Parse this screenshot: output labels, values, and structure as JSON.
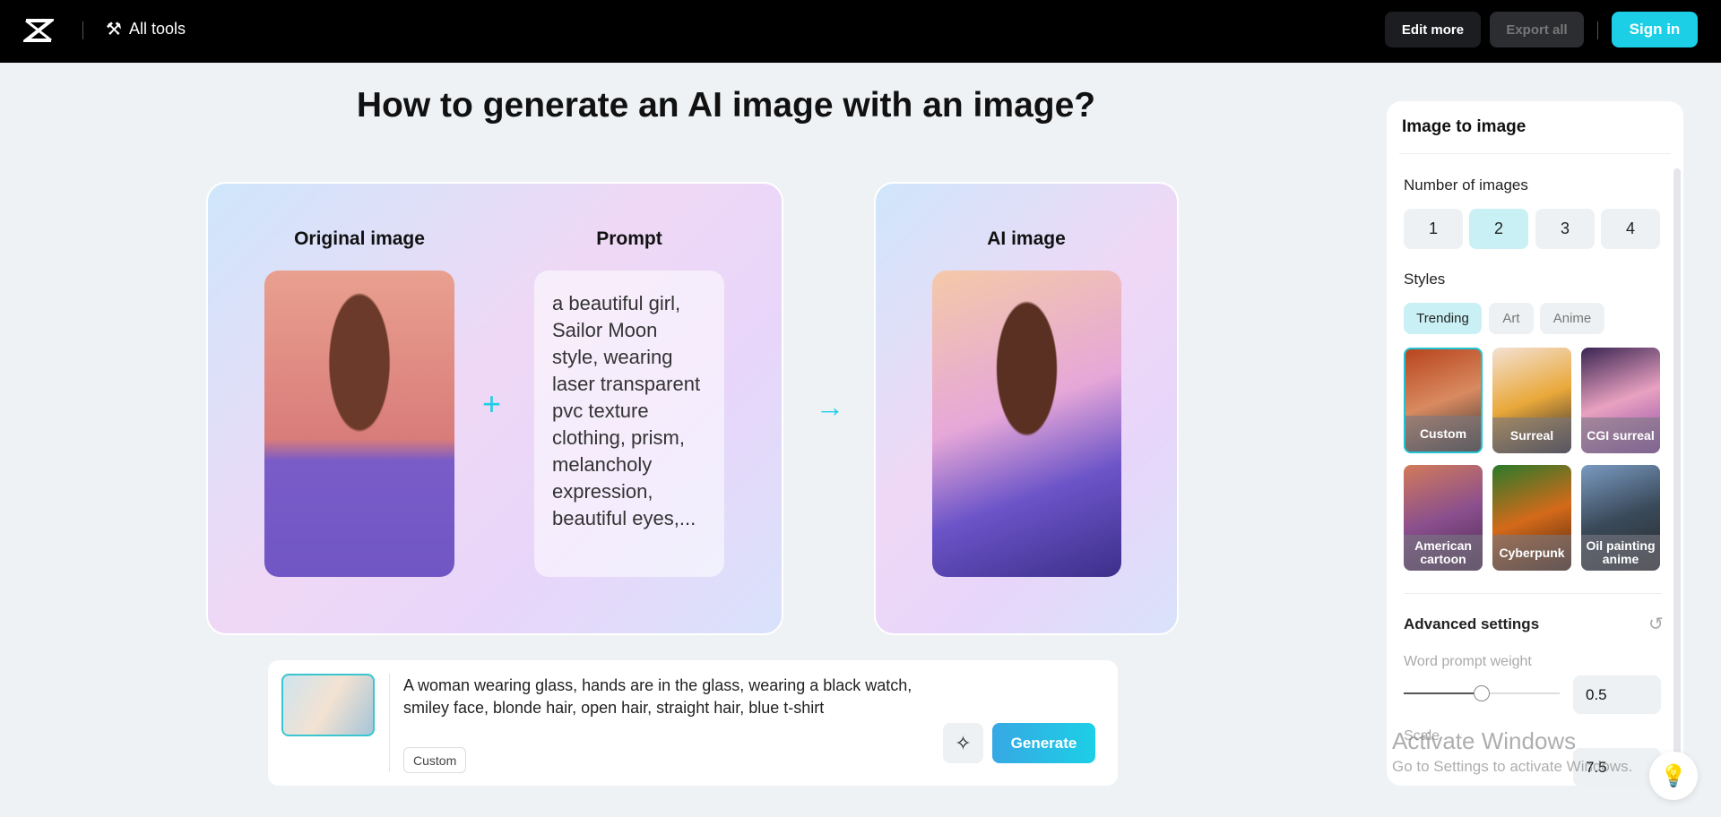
{
  "header": {
    "logo": "capcut-logo",
    "all_tools": "All tools",
    "edit_more": "Edit more",
    "export_all": "Export all",
    "sign_in": "Sign in"
  },
  "main": {
    "title": "How to generate an AI image with an image?",
    "original_label": "Original image",
    "prompt_label": "Prompt",
    "prompt_text": "a beautiful girl, Sailor Moon style, wearing laser transparent pvc texture clothing, prism, melancholy expression, beautiful eyes,...",
    "ai_label": "AI image"
  },
  "prompt_bar": {
    "text": "A woman wearing glass, hands are in the glass, wearing a black watch, smiley face, blonde hair, open hair, straight hair, blue t-shirt",
    "style_tag": "Custom",
    "generate": "Generate"
  },
  "panel": {
    "title": "Image to image",
    "number_label": "Number of images",
    "numbers": [
      "1",
      "2",
      "3",
      "4"
    ],
    "selected_number": "2",
    "styles_label": "Styles",
    "style_tabs": [
      "Trending",
      "Art",
      "Anime"
    ],
    "active_tab": "Trending",
    "styles": [
      "Custom",
      "Surreal",
      "CGI surreal",
      "American cartoon",
      "Cyberpunk",
      "Oil painting anime"
    ],
    "selected_style": "Custom",
    "advanced_label": "Advanced settings",
    "word_weight_label": "Word prompt weight",
    "word_weight": "0.5",
    "word_weight_fraction": 0.5,
    "scale_label": "Scale",
    "scale": "7.5"
  },
  "watermark": {
    "line1": "Activate Windows",
    "line2": "Go to Settings to activate Windows."
  },
  "colors": {
    "accent": "#1ccfe6",
    "selected_bg": "#c9f1f5"
  }
}
